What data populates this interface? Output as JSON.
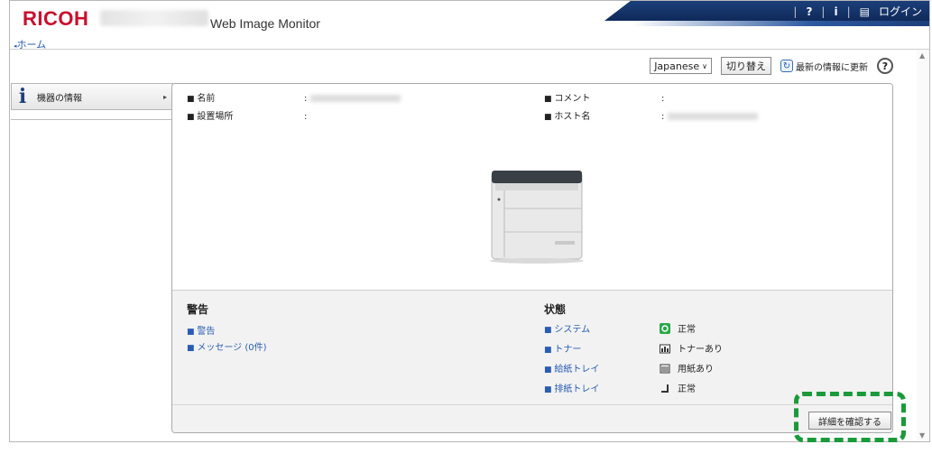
{
  "header": {
    "brand": "RICOH",
    "app_title": "Web Image Monitor",
    "top_links": {
      "help": "?",
      "info": "i",
      "login": "ログイン"
    }
  },
  "nav": {
    "home": "ホーム"
  },
  "toolbar": {
    "language": "Japanese",
    "switch_label": "切り替え",
    "refresh_label": "最新の情報に更新",
    "help": "?"
  },
  "sidebar": {
    "items": [
      {
        "label": "機器の情報"
      }
    ]
  },
  "device_info": {
    "name_label": "名前",
    "location_label": "設置場所",
    "location_value": ":",
    "comment_label": "コメント",
    "comment_value": ":",
    "host_label": "ホスト名",
    "colon": ":"
  },
  "alerts": {
    "title": "警告",
    "items": [
      "警告",
      "メッセージ (0件)"
    ]
  },
  "status": {
    "title": "状態",
    "items": [
      {
        "label": "システム",
        "value": "正常",
        "icon": "system-ok-icon"
      },
      {
        "label": "トナー",
        "value": "トナーあり",
        "icon": "toner-icon"
      },
      {
        "label": "給紙トレイ",
        "value": "用紙あり",
        "icon": "paper-tray-icon"
      },
      {
        "label": "排紙トレイ",
        "value": "正常",
        "icon": "output-tray-icon"
      }
    ]
  },
  "detail_button": "詳細を確認する",
  "colors": {
    "brand": "#c8102e",
    "banner": "#1c3f7a",
    "highlight": "#1a9a3a",
    "link": "#2a5db0"
  }
}
